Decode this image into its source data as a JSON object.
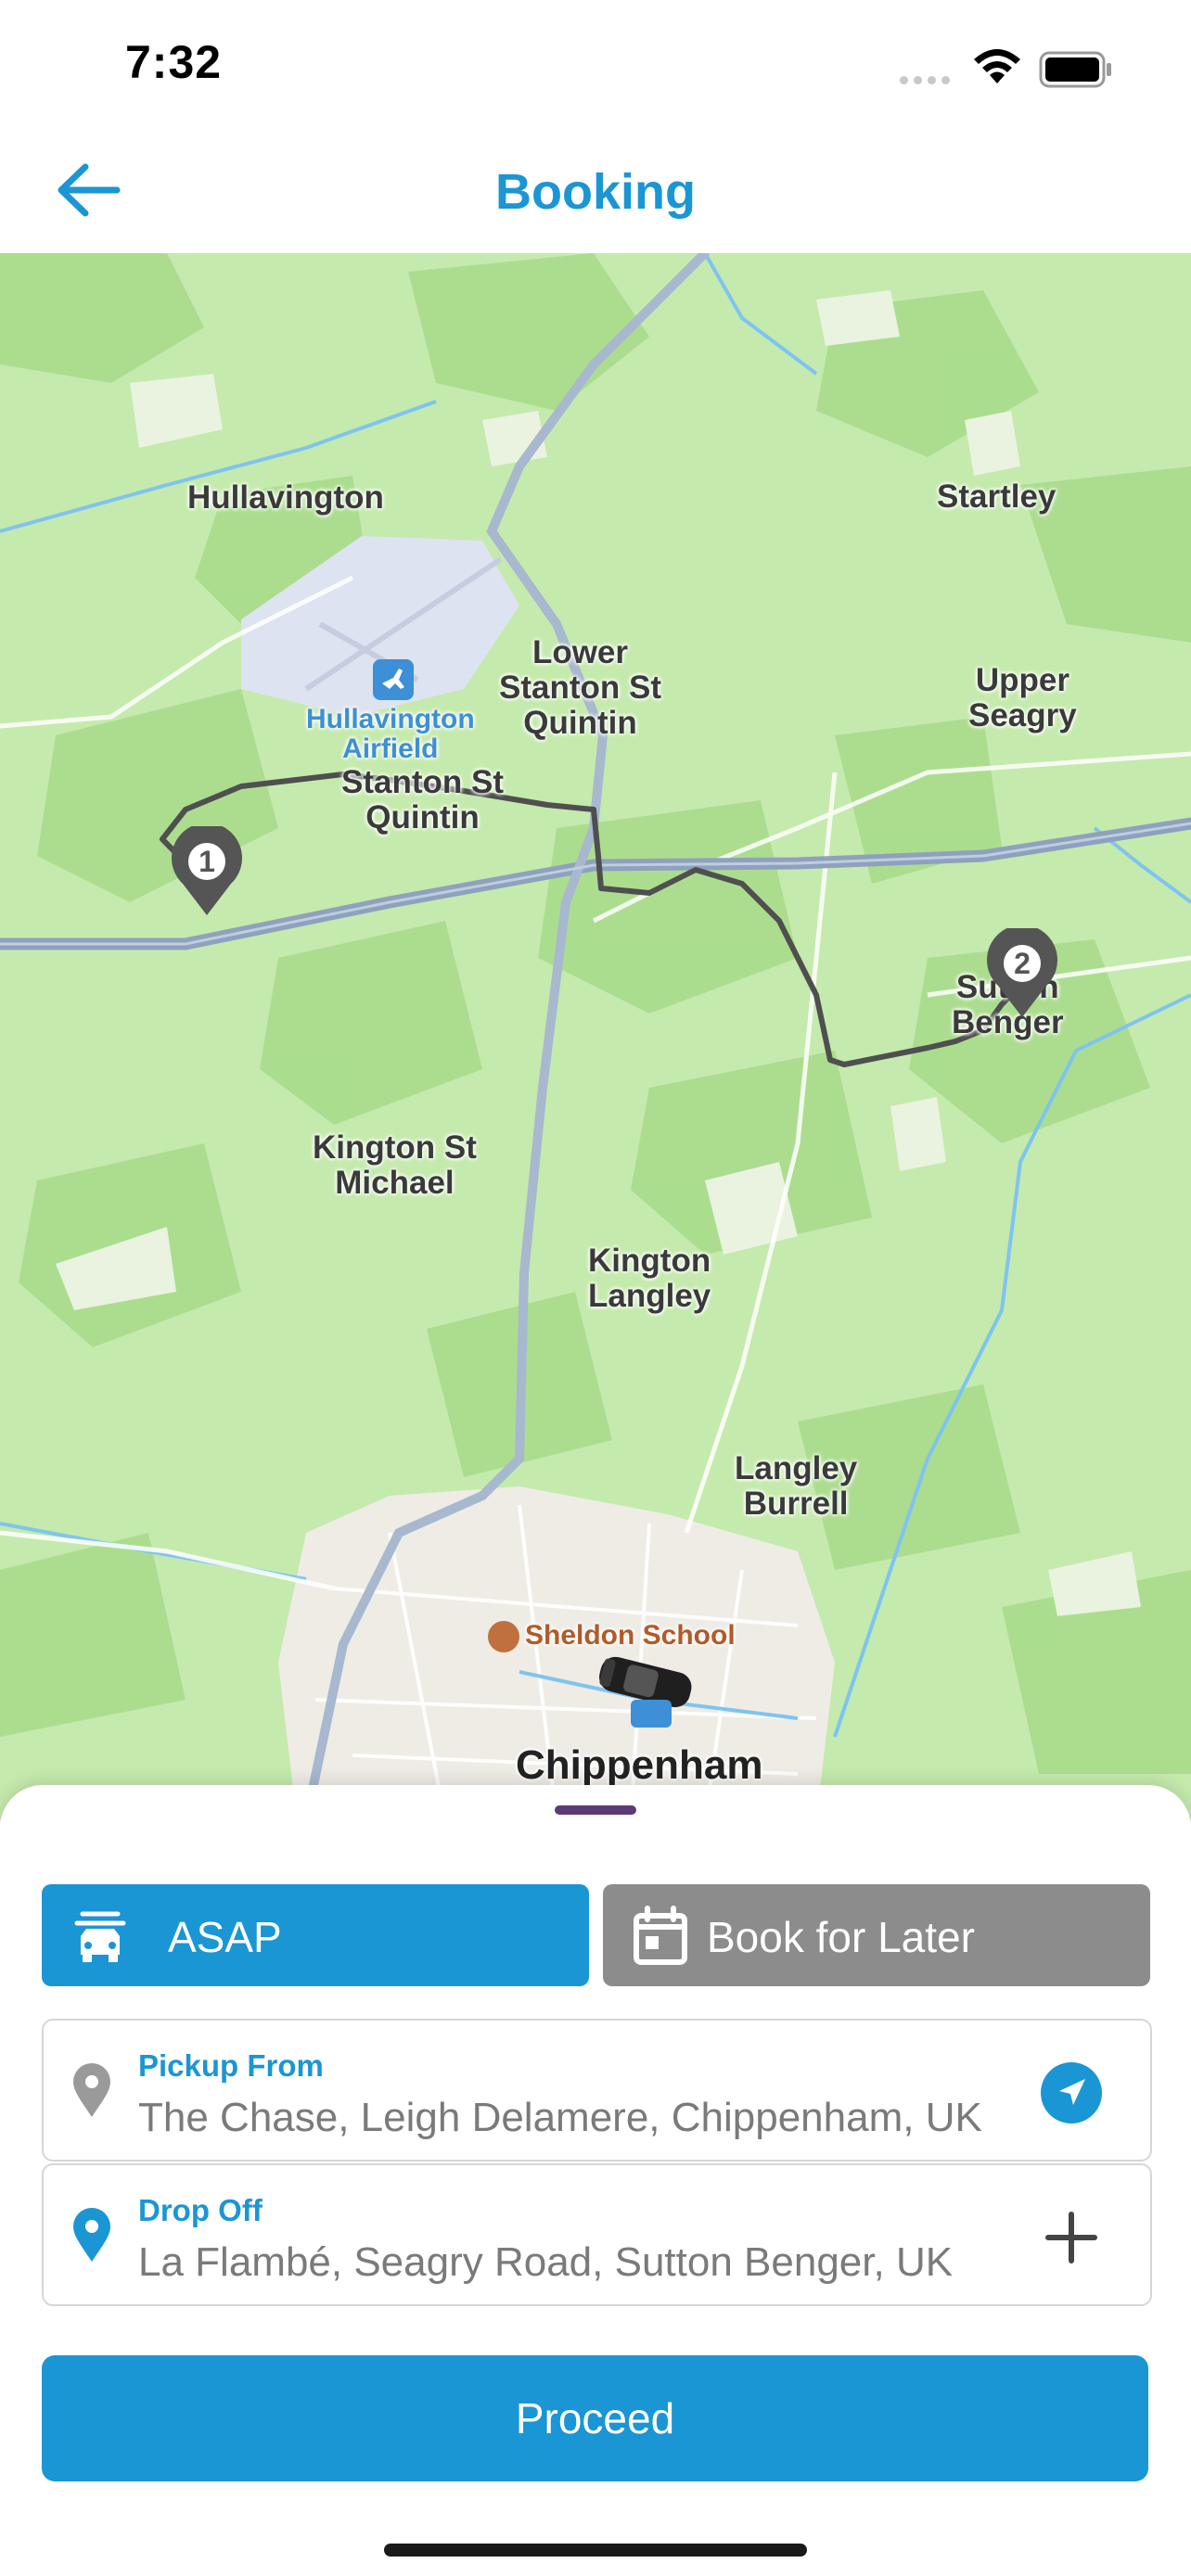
{
  "status_bar": {
    "time": "7:32"
  },
  "nav": {
    "title": "Booking",
    "back_icon": "arrow-left-icon"
  },
  "map": {
    "places": {
      "hullavington": "Hullavington",
      "airfield_1": "Hullavington",
      "airfield_2": "Airfield",
      "lower_stanton_1": "Lower",
      "lower_stanton_2": "Stanton St",
      "lower_stanton_3": "Quintin",
      "stanton_1": "Stanton St",
      "stanton_2": "Quintin",
      "startley": "Startley",
      "upper_seagry_1": "Upper",
      "upper_seagry_2": "Seagry",
      "sutton_1": "Sutton",
      "sutton_2": "Benger",
      "kington_st_michael_1": "Kington St",
      "kington_st_michael_2": "Michael",
      "kington_langley_1": "Kington",
      "kington_langley_2": "Langley",
      "langley_burrell_1": "Langley",
      "langley_burrell_2": "Burrell",
      "sheldon_school": "Sheldon School",
      "chippenham": "Chippenham"
    },
    "markers": {
      "pickup": "1",
      "dropoff": "2"
    },
    "route_color": "#555555"
  },
  "booking": {
    "asap_label": "ASAP",
    "later_label": "Book for Later",
    "pickup_label": "Pickup From",
    "pickup_value": "The Chase, Leigh Delamere, Chippenham, UK",
    "dropoff_label": "Drop Off",
    "dropoff_value": "La Flambé, Seagry Road, Sutton Benger, UK",
    "proceed_label": "Proceed"
  },
  "colors": {
    "accent": "#1a96d5",
    "disabled": "#8c8c8c"
  }
}
